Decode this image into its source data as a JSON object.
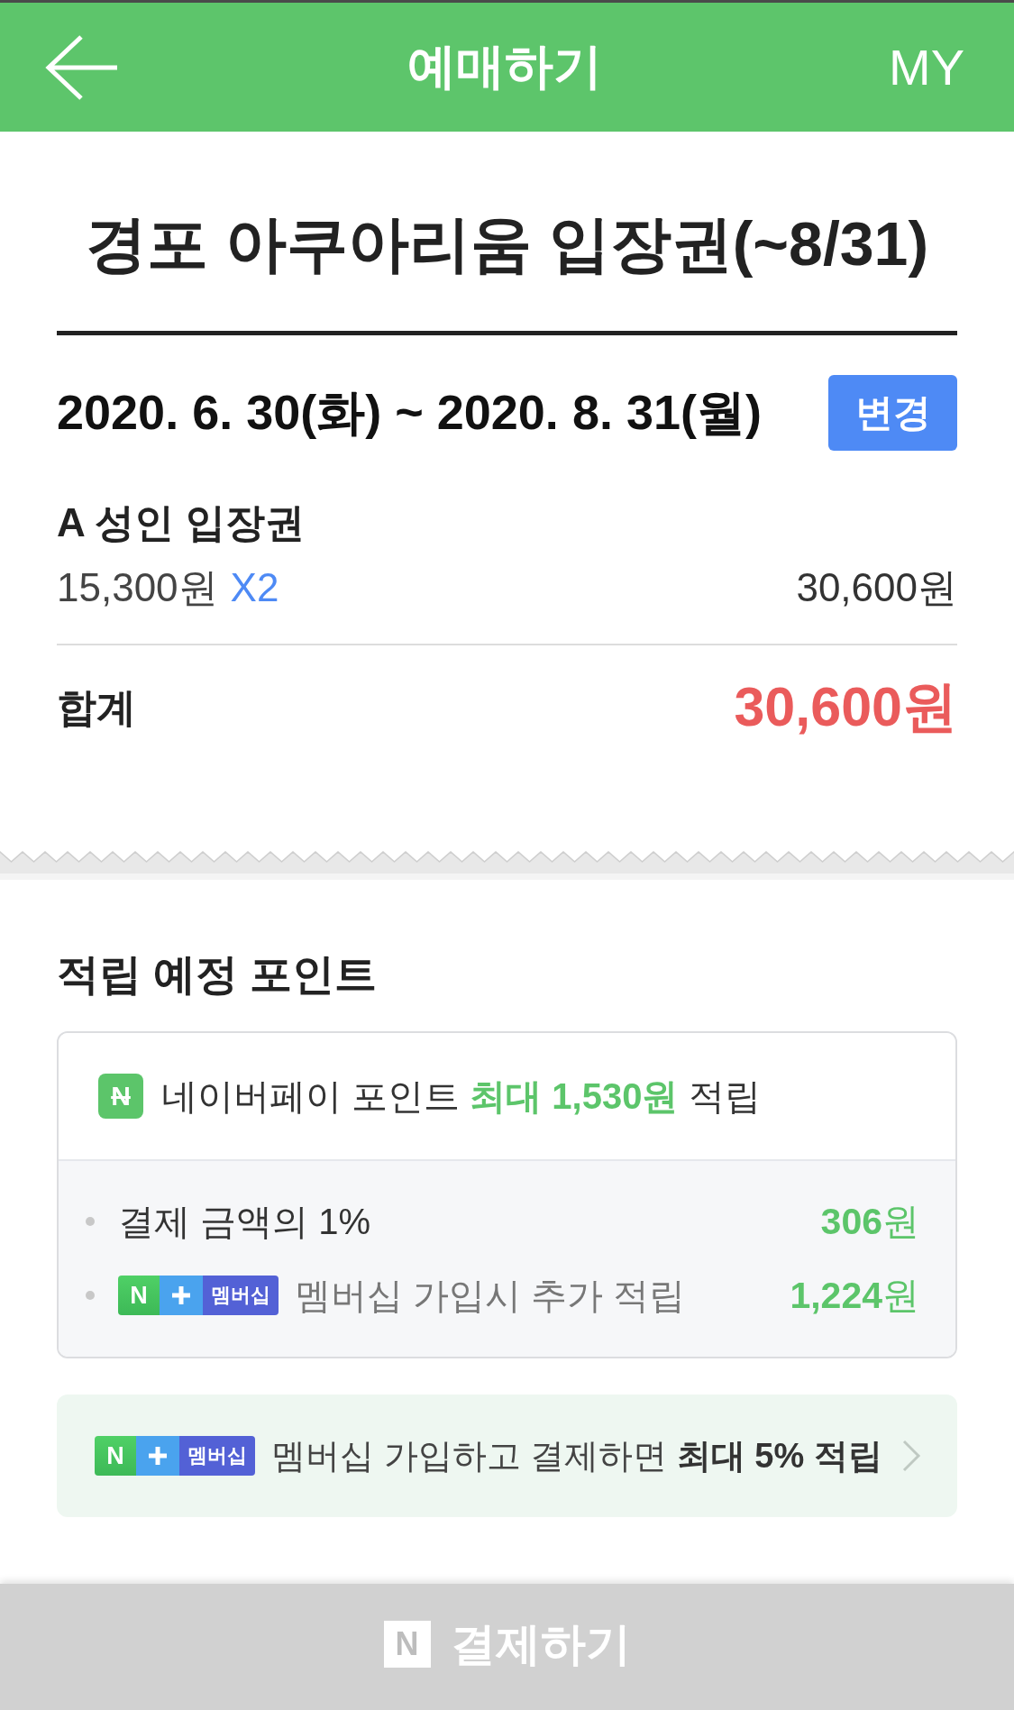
{
  "header": {
    "title": "예매하기",
    "my_link": "MY"
  },
  "product": {
    "title": "경포 아쿠아리움 입장권(~8/31)",
    "date_range": "2020. 6. 30(화) ~ 2020. 8. 31(월)",
    "change_button": "변경"
  },
  "tickets": [
    {
      "name": "A 성인 입장권",
      "unit_price": "15,300원",
      "quantity": "X2",
      "subtotal": "30,600원"
    }
  ],
  "total": {
    "label": "합계",
    "amount": "30,600원"
  },
  "points": {
    "heading": "적립 예정 포인트",
    "summary": {
      "logo": "N",
      "text": "네이버페이 포인트 **최대 1,530원** 적립"
    },
    "details": [
      {
        "kind": "plain",
        "label": "결제 금액의 1%",
        "amount": "**306**원"
      },
      {
        "kind": "membership",
        "badge": {
          "mark": "N",
          "label": "멤버십"
        },
        "label": "멤버십 가입시 추가 적립",
        "amount": "**1,224**원"
      }
    ]
  },
  "banner": {
    "badge": {
      "mark": "N",
      "label": "멤버십"
    },
    "text": "멤버십 가입하고 결제하면 **최대 5% 적립**"
  },
  "pay_button": {
    "logo": "N",
    "label": "결제하기"
  }
}
